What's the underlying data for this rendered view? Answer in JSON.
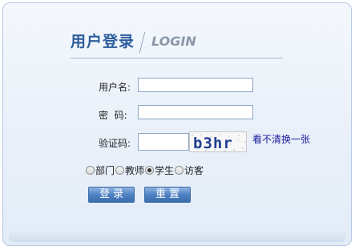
{
  "header": {
    "title_cn": "用户登录",
    "title_en": "LOGIN"
  },
  "form": {
    "username_label": "用户名:",
    "password_label": "密  码:",
    "captcha_label": "验证码:",
    "username_value": "",
    "password_value": "",
    "captcha_value": "",
    "captcha_image_text": "b3hr",
    "captcha_refresh_link": "看不清换一张"
  },
  "roles": {
    "options": [
      "部门",
      "教师",
      "学生",
      "访客"
    ],
    "selected": "学生"
  },
  "buttons": {
    "login_label": "登录",
    "reset_label": "重置"
  },
  "colors": {
    "title_color": "#2c5d9c",
    "button_blue": "#4f82c3",
    "link_color": "#1a1a9c"
  }
}
